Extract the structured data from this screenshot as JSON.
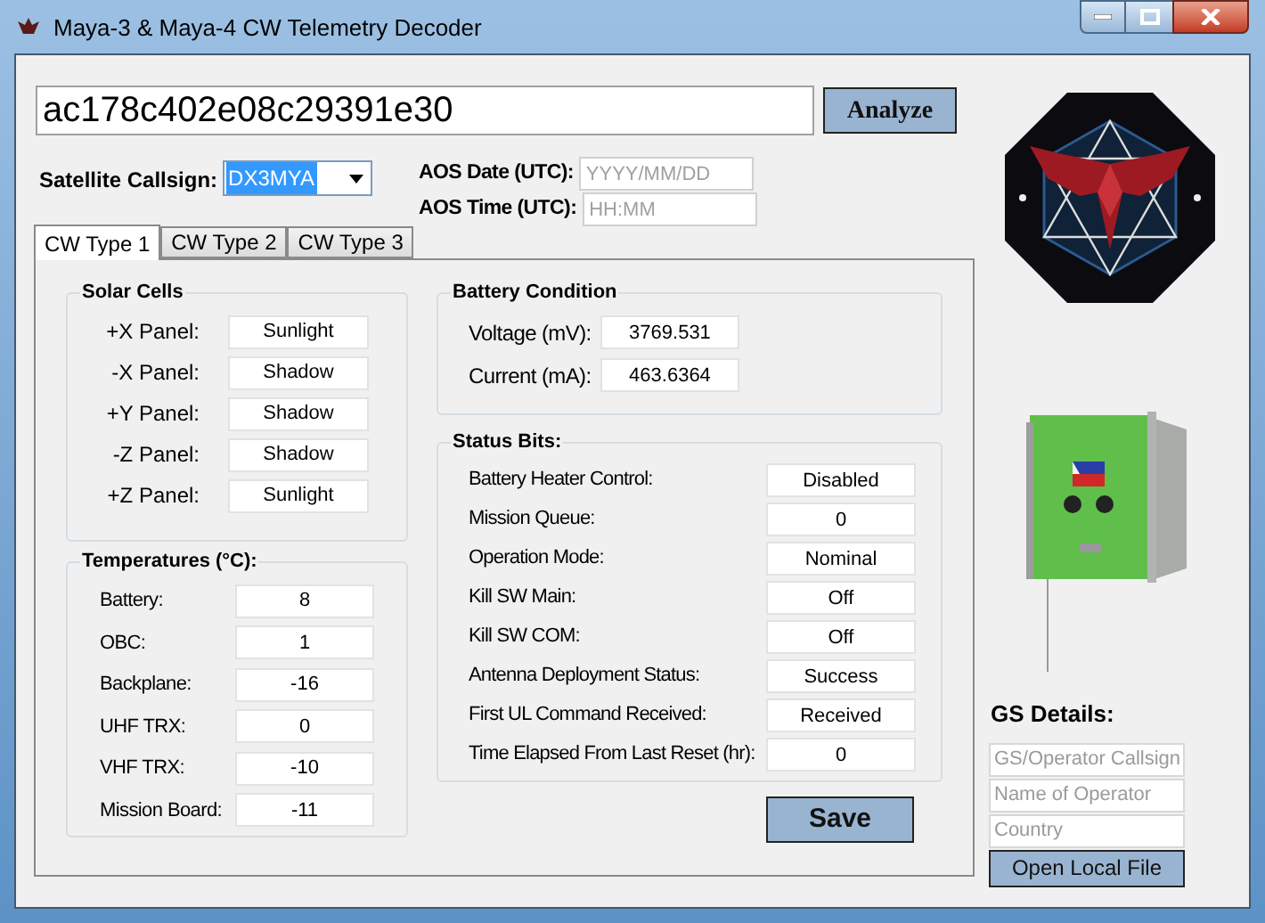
{
  "window": {
    "title": "Maya-3 & Maya-4 CW Telemetry Decoder"
  },
  "hex_input": {
    "value": "ac178c402e08c29391e30"
  },
  "analyze_button": "Analyze",
  "callsign": {
    "label": "Satellite Callsign:",
    "value": "DX3MYA",
    "highlighted": true
  },
  "aos_date": {
    "label": "AOS Date (UTC):",
    "placeholder": "YYYY/MM/DD"
  },
  "aos_time": {
    "label": "AOS Time (UTC):",
    "placeholder": "HH:MM"
  },
  "tabs": [
    {
      "label": "CW Type 1",
      "selected": true
    },
    {
      "label": "CW Type 2",
      "selected": false
    },
    {
      "label": "CW Type 3",
      "selected": false
    }
  ],
  "solar_cells": {
    "title": "Solar Cells",
    "rows": [
      {
        "label": "+X Panel:",
        "value": "Sunlight"
      },
      {
        "label": "-X Panel:",
        "value": "Shadow"
      },
      {
        "label": "+Y Panel:",
        "value": "Shadow"
      },
      {
        "label": "-Z Panel:",
        "value": "Shadow"
      },
      {
        "label": "+Z Panel:",
        "value": "Sunlight"
      }
    ]
  },
  "temperatures": {
    "title": "Temperatures (°C):",
    "rows": [
      {
        "label": "Battery:",
        "value": "8"
      },
      {
        "label": "OBC:",
        "value": "1"
      },
      {
        "label": "Backplane:",
        "value": "-16"
      },
      {
        "label": "UHF TRX:",
        "value": "0"
      },
      {
        "label": "VHF TRX:",
        "value": "-10"
      },
      {
        "label": "Mission Board:",
        "value": "-11"
      }
    ]
  },
  "battery_condition": {
    "title": "Battery Condition",
    "rows": [
      {
        "label": "Voltage (mV):",
        "value": "3769.531"
      },
      {
        "label": "Current (mA):",
        "value": "463.6364"
      }
    ]
  },
  "status_bits": {
    "title": "Status Bits:",
    "rows": [
      {
        "label": "Battery Heater Control:",
        "value": "Disabled"
      },
      {
        "label": "Mission Queue:",
        "value": "0"
      },
      {
        "label": "Operation Mode:",
        "value": "Nominal"
      },
      {
        "label": "Kill SW Main:",
        "value": "Off"
      },
      {
        "label": "Kill SW COM:",
        "value": "Off"
      },
      {
        "label": "Antenna Deployment Status:",
        "value": "Success"
      },
      {
        "label": "First UL Command Received:",
        "value": "Received"
      },
      {
        "label": "Time Elapsed From Last Reset (hr):",
        "value": "0"
      }
    ]
  },
  "save_button": "Save",
  "gs_details": {
    "title": "GS Details:",
    "fields": [
      {
        "placeholder": "GS/Operator Callsign"
      },
      {
        "placeholder": "Name of Operator"
      },
      {
        "placeholder": "Country"
      }
    ],
    "button": "Open Local File"
  }
}
